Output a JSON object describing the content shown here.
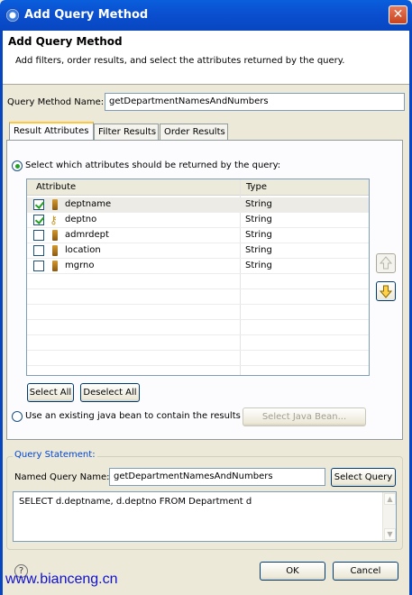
{
  "window": {
    "title": "Add Query Method"
  },
  "header": {
    "title": "Add Query Method",
    "description": "Add filters, order results, and select the attributes returned by the query."
  },
  "query_method": {
    "label": "Query Method Name:",
    "value": "getDepartmentNamesAndNumbers"
  },
  "tabs": [
    {
      "label": "Result Attributes",
      "active": true
    },
    {
      "label": "Filter Results",
      "active": false
    },
    {
      "label": "Order Results",
      "active": false
    }
  ],
  "result_attributes": {
    "radio_select_label": "Select which attributes should be returned by the query:",
    "radio_select_checked": true,
    "columns": [
      "Attribute",
      "Type"
    ],
    "rows": [
      {
        "name": "deptname",
        "type": "String",
        "checked": true,
        "icon": "attribute-icon"
      },
      {
        "name": "deptno",
        "type": "String",
        "checked": true,
        "icon": "key-attribute-icon"
      },
      {
        "name": "admrdept",
        "type": "String",
        "checked": false,
        "icon": "attribute-icon"
      },
      {
        "name": "location",
        "type": "String",
        "checked": false,
        "icon": "attribute-icon"
      },
      {
        "name": "mgrno",
        "type": "String",
        "checked": false,
        "icon": "attribute-icon"
      }
    ],
    "select_all": "Select All",
    "deselect_all": "Deselect All",
    "radio_bean_label": "Use an existing java bean to contain the results",
    "radio_bean_checked": false,
    "select_bean": "Select Java Bean..."
  },
  "query_statement": {
    "group_title": "Query Statement:",
    "named_label": "Named Query Name:",
    "named_value": "getDepartmentNamesAndNumbers",
    "select_query": "Select Query",
    "sql": "SELECT d.deptname, d.deptno FROM Department d"
  },
  "footer": {
    "ok": "OK",
    "cancel": "Cancel",
    "help": "?"
  },
  "watermark": "www.bianceng.cn"
}
